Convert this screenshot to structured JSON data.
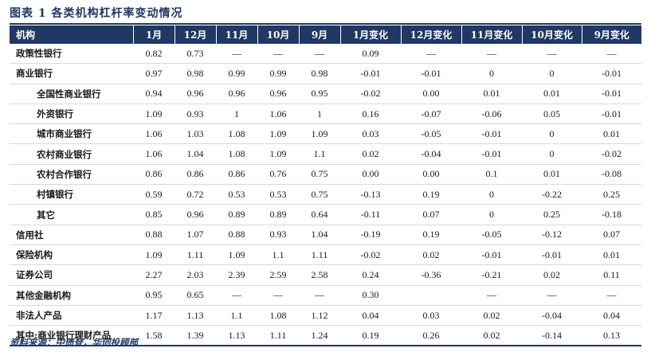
{
  "title": "图表 1   各类机构杠杆率变动情况",
  "columns": [
    "机构",
    "1月",
    "12月",
    "11月",
    "10月",
    "9月",
    "1月变化",
    "12月变化",
    "11月变化",
    "10月变化",
    "9月变化"
  ],
  "rows": [
    {
      "name": "政策性银行",
      "level": 0,
      "cells": [
        "0.82",
        "0.73",
        "—",
        "—",
        "—",
        "0.09",
        "—",
        "—",
        "—",
        "—"
      ]
    },
    {
      "name": "商业银行",
      "level": 0,
      "cells": [
        "0.97",
        "0.98",
        "0.99",
        "0.99",
        "0.98",
        "-0.01",
        "-0.01",
        "0",
        "0",
        "-0.01"
      ]
    },
    {
      "name": "全国性商业银行",
      "level": 1,
      "cells": [
        "0.94",
        "0.96",
        "0.96",
        "0.96",
        "0.95",
        "-0.02",
        "0.00",
        "0.01",
        "0.01",
        "-0.01"
      ]
    },
    {
      "name": "外资银行",
      "level": 1,
      "cells": [
        "1.09",
        "0.93",
        "1",
        "1.06",
        "1",
        "0.16",
        "-0.07",
        "-0.06",
        "0.05",
        "-0.01"
      ]
    },
    {
      "name": "城市商业银行",
      "level": 1,
      "cells": [
        "1.06",
        "1.03",
        "1.08",
        "1.09",
        "1.09",
        "0.03",
        "-0.05",
        "-0.01",
        "0",
        "0.01"
      ]
    },
    {
      "name": "农村商业银行",
      "level": 1,
      "cells": [
        "1.06",
        "1.04",
        "1.08",
        "1.09",
        "1.1",
        "0.02",
        "-0.04",
        "-0.01",
        "0",
        "-0.02"
      ]
    },
    {
      "name": "农村合作银行",
      "level": 1,
      "cells": [
        "0.86",
        "0.86",
        "0.86",
        "0.76",
        "0.75",
        "0.00",
        "0.00",
        "0.1",
        "0.01",
        "-0.08"
      ]
    },
    {
      "name": "村镇银行",
      "level": 1,
      "cells": [
        "0.59",
        "0.72",
        "0.53",
        "0.53",
        "0.75",
        "-0.13",
        "0.19",
        "0",
        "-0.22",
        "0.25"
      ]
    },
    {
      "name": "其它",
      "level": 1,
      "cells": [
        "0.85",
        "0.96",
        "0.89",
        "0.89",
        "0.64",
        "-0.11",
        "0.07",
        "0",
        "0.25",
        "-0.18"
      ]
    },
    {
      "name": "信用社",
      "level": 0,
      "cells": [
        "0.88",
        "1.07",
        "0.88",
        "0.93",
        "1.04",
        "-0.19",
        "0.19",
        "-0.05",
        "-0.12",
        "0.07"
      ]
    },
    {
      "name": "保险机构",
      "level": 0,
      "cells": [
        "1.09",
        "1.11",
        "1.09",
        "1.1",
        "1.11",
        "-0.02",
        "0.02",
        "-0.01",
        "-0.01",
        "0.01"
      ]
    },
    {
      "name": "证券公司",
      "level": 0,
      "cells": [
        "2.27",
        "2.03",
        "2.39",
        "2.59",
        "2.58",
        "0.24",
        "-0.36",
        "-0.21",
        "0.02",
        "0.11"
      ]
    },
    {
      "name": "其他金融机构",
      "level": 0,
      "cells": [
        "0.95",
        "0.65",
        "—",
        "—",
        "—",
        "0.30",
        "",
        "—",
        "—",
        "—"
      ]
    },
    {
      "name": "非法人产品",
      "level": 0,
      "cells": [
        "1.17",
        "1.13",
        "1.1",
        "1.08",
        "1.12",
        "0.04",
        "0.03",
        "0.02",
        "-0.04",
        "0.04"
      ]
    },
    {
      "name": "其中:商业银行理财产品",
      "level": 0,
      "cells": [
        "1.58",
        "1.39",
        "1.13",
        "1.11",
        "1.24",
        "0.19",
        "0.26",
        "0.02",
        "-0.14",
        "0.13"
      ]
    }
  ],
  "source": "资料来源：中债登，华创投顾部",
  "colors": {
    "header_bg": "#1f3864",
    "header_text": "#ffffff"
  }
}
